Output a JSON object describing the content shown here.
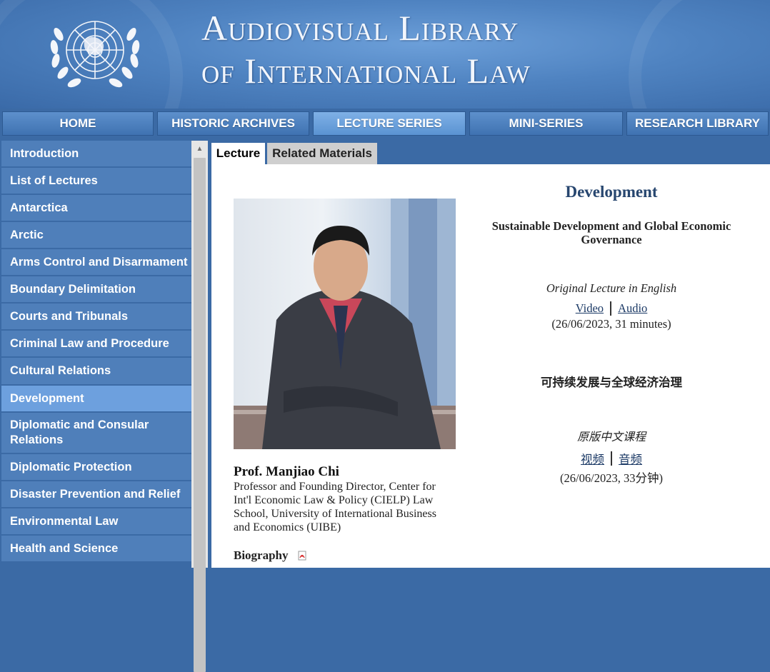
{
  "banner": {
    "title_line1": "Audiovisual Library",
    "title_line2": "of International Law",
    "emblem": "un-emblem-icon"
  },
  "nav": {
    "tabs": [
      {
        "label": "HOME",
        "active": false
      },
      {
        "label": "HISTORIC ARCHIVES",
        "active": false
      },
      {
        "label": "LECTURE SERIES",
        "active": true
      },
      {
        "label": "MINI-SERIES",
        "active": false
      },
      {
        "label": "RESEARCH LIBRARY",
        "active": false
      }
    ]
  },
  "sidebar": {
    "items": [
      {
        "label": "Introduction"
      },
      {
        "label": "List of Lectures"
      },
      {
        "label": "Antarctica"
      },
      {
        "label": "Arctic"
      },
      {
        "label": "Arms Control and Disarmament"
      },
      {
        "label": "Boundary Delimitation"
      },
      {
        "label": "Courts and Tribunals"
      },
      {
        "label": "Criminal Law and Procedure"
      },
      {
        "label": "Cultural Relations"
      },
      {
        "label": "Development"
      },
      {
        "label": "Diplomatic and Consular Relations"
      },
      {
        "label": "Diplomatic Protection"
      },
      {
        "label": "Disaster Prevention and Relief"
      },
      {
        "label": "Environmental Law"
      },
      {
        "label": "Health and Science"
      }
    ],
    "active": "Development"
  },
  "content": {
    "tabs": [
      {
        "label": "Lecture",
        "active": true
      },
      {
        "label": "Related Materials",
        "active": false
      }
    ],
    "topic": "Development",
    "lecture_title": "Sustainable Development and Global Economic Governance",
    "english": {
      "original_label": "Original Lecture in English",
      "video": "Video",
      "audio": "Audio",
      "date": "(26/06/2023, 31 minutes)"
    },
    "chinese": {
      "title": "可持续发展与全球经济治理",
      "original_label": "原版中文课程",
      "video": "视频",
      "audio": "音频",
      "date": "(26/06/2023, 33分钟)"
    },
    "lecturer": {
      "name": "Prof. Manjiao Chi",
      "description": "Professor and Founding Director, Center for Int'l Economic Law & Policy (CIELP) Law School, University of International Business and Economics (UIBE)"
    },
    "biography_label": "Biography",
    "biography_icon": "pdf-icon"
  },
  "colors": {
    "page_bg": "#3b6aa5",
    "sidebar_item": "#4f7fba",
    "sidebar_active": "#6da0de",
    "topic_title": "#27466f",
    "link": "#1c3a66"
  }
}
